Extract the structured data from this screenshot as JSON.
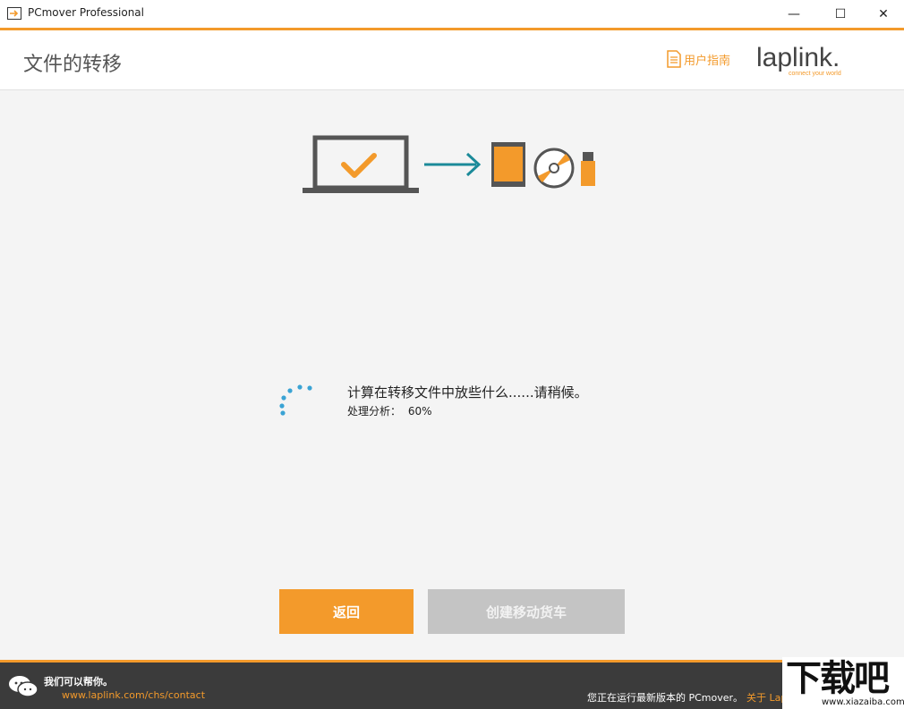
{
  "window": {
    "title": "PCmover Professional",
    "minimize": "—",
    "maximize": "☐",
    "close": "✕"
  },
  "header": {
    "title": "文件的转移",
    "guide_label": "用户指南",
    "logo_text": "laplink.",
    "logo_tagline": "connect your world"
  },
  "status": {
    "message": "计算在转移文件中放些什么......请稍候。",
    "progress_label": "处理分析：",
    "progress_value": "60%",
    "progress": 0.6
  },
  "buttons": {
    "back": "返回",
    "create": "创建移动货车"
  },
  "footer": {
    "help_title": "我们可以帮你。",
    "help_link": "www.laplink.com/chs/contact",
    "version_text": "您正在运行最新版本的 PCmover。",
    "about_text": "关于 Laplink"
  },
  "watermark": {
    "big": "下载吧",
    "small": "www.xiazaiba.com"
  },
  "colors": {
    "accent": "#f39a2b",
    "teal": "#1b8a99",
    "spinner": "#3aa3d4",
    "footer_bg": "#3b3b3b"
  }
}
